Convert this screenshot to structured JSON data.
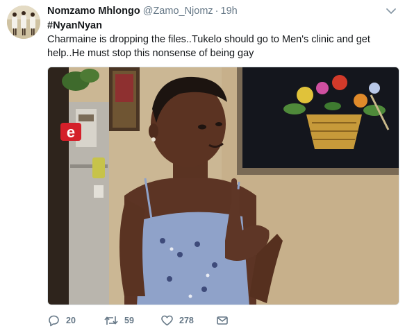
{
  "tweet": {
    "author_name": "Nomzamo Mhlongo",
    "author_handle": "@Zamo_Njomz",
    "separator": "·",
    "timestamp": "19h",
    "hashtag": "#NyanNyan",
    "body_line1": "Charmaine is dropping the files..Tukelo should go to Men's clinic and get",
    "body_line2": "help..He must stop this nonsense of being gay"
  },
  "media": {
    "channel_logo_text": "e"
  },
  "actions": {
    "reply_count": "20",
    "retweet_count": "59",
    "like_count": "278"
  },
  "icons": {
    "menu": "chevron-down-icon",
    "reply": "reply-icon",
    "retweet": "retweet-icon",
    "like": "heart-icon",
    "dm": "envelope-icon"
  },
  "colors": {
    "text": "#14171a",
    "muted": "#657786",
    "channel_logo_red": "#d4202a"
  }
}
